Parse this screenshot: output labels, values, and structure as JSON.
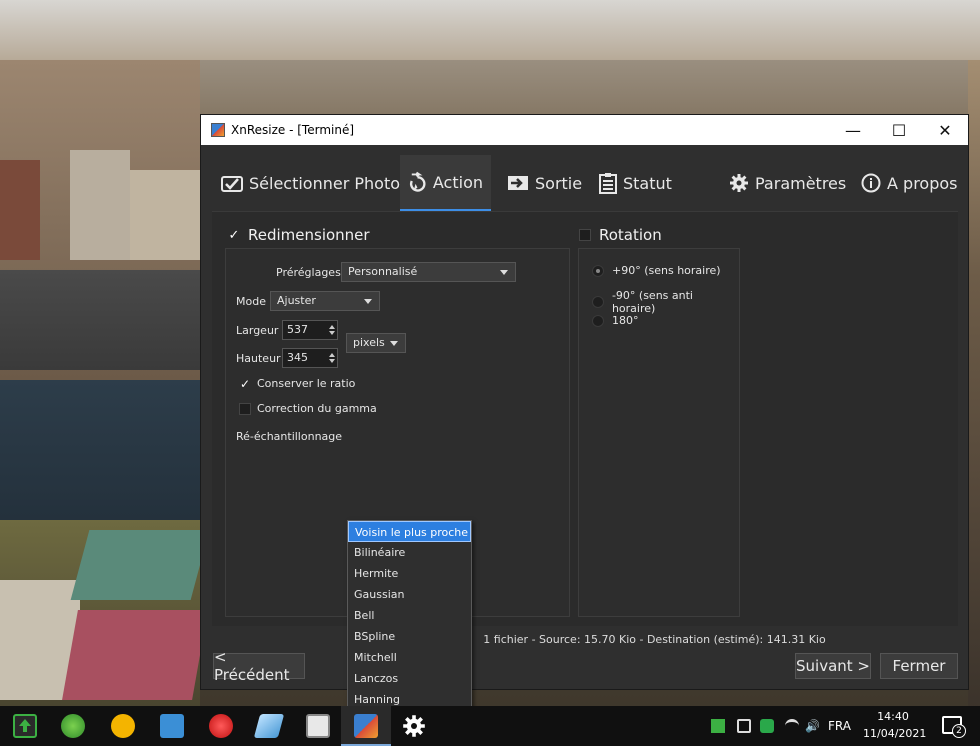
{
  "window": {
    "title": "XnResize - [Terminé]",
    "controls": [
      "—",
      "☐",
      "✕"
    ]
  },
  "tabs": [
    {
      "label": "Sélectionner Photos",
      "icon": "select-photos-icon"
    },
    {
      "label": "Action",
      "icon": "action-icon",
      "active": true
    },
    {
      "label": "Sortie",
      "icon": "output-icon"
    },
    {
      "label": "Statut",
      "icon": "status-icon"
    },
    {
      "label": "Paramètres",
      "icon": "gear-icon"
    },
    {
      "label": "A propos",
      "icon": "info-icon"
    }
  ],
  "resize": {
    "title": "Redimensionner",
    "checked": true,
    "presets_label": "Préréglages",
    "presets_value": "Personnalisé",
    "mode_label": "Mode",
    "mode_value": "Ajuster",
    "width_label": "Largeur",
    "width_value": "537",
    "height_label": "Hauteur",
    "height_value": "345",
    "unit_value": "pixels",
    "keep_ratio_label": "Conserver le ratio",
    "keep_ratio_checked": true,
    "gamma_label": "Correction du gamma",
    "gamma_checked": false,
    "resample_label": "Ré-échantillonnage",
    "resample_options": [
      "Voisin le plus proche",
      "Bilinéaire",
      "Hermite",
      "Gaussian",
      "Bell",
      "BSpline",
      "Mitchell",
      "Lanczos",
      "Hanning"
    ],
    "resample_selected": "Voisin le plus proche"
  },
  "rotation": {
    "title": "Rotation",
    "checked": false,
    "options": [
      "+90° (sens horaire)",
      "-90° (sens anti horaire)",
      "180°"
    ],
    "selected": "+90° (sens horaire)"
  },
  "status_text": "1 fichier - Source: 15.70 Kio - Destination (estimé): 141.31 Kio",
  "buttons": {
    "previous": "< Précédent",
    "next": "Suivant >",
    "close": "Fermer"
  },
  "taskbar": {
    "language": "FRA",
    "time": "14:40",
    "date": "11/04/2021",
    "notification_count": "2"
  }
}
